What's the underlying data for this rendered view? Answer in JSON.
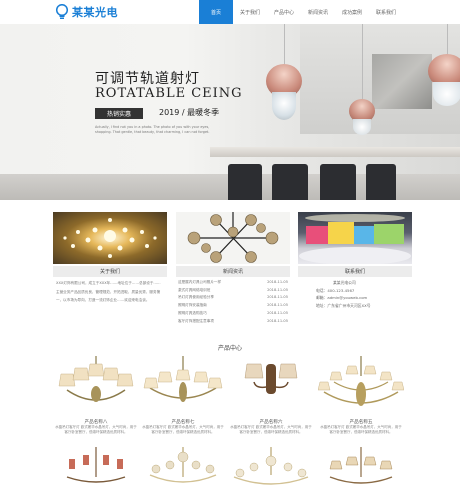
{
  "header": {
    "logo_text": "某某光电",
    "nav": [
      "首页",
      "关于我们",
      "产品中心",
      "新闻资讯",
      "成功案例",
      "联系我们"
    ],
    "active_index": 0,
    "accent_color": "#1a7fd6"
  },
  "banner": {
    "title_cn": "可调节轨道射灯",
    "title_en": "ROTATABLE CEING",
    "button_label": "热销实惠",
    "season_text": "2019 / 最暖冬季",
    "desc": "Actually, I find not you in a photo. The photo of you with your eyes, shopping. That gentle, that beauty, that charming, I can not forget."
  },
  "about": {
    "title": "关于我们",
    "text": "XXX灯饰有限公司，成立于XXX年……地址位于……总部设于……主营业务产品品质优良，管理规范，开拓进取，质量优秀，服务第一，以市场为导向，打造一流灯饰企业……欢迎来电洽谈。"
  },
  "news": {
    "title": "新闻资讯",
    "items": [
      {
        "text": "这是展内灯具公司照片一样",
        "date": "2018-11-05"
      },
      {
        "text": "激式灯具网络培训班",
        "date": "2018-11-05"
      },
      {
        "text": "吊灯灯具使用经验分享",
        "date": "2018-11-05"
      },
      {
        "text": "照明灯饰安装指南",
        "date": "2018-11-05"
      },
      {
        "text": "照明灯具选购技巧",
        "date": "2018-11-05"
      },
      {
        "text": "客厅灯饰搭配注意事项",
        "date": "2018-11-05"
      }
    ]
  },
  "contact": {
    "title": "联系我们",
    "company": "某某光电公司",
    "phone": "电话：400-123-4567",
    "email": "邮箱：admin@youweb.com",
    "address": "地址：广东省广州市天河区XX号"
  },
  "products": {
    "title": "产品中心",
    "items": [
      {
        "name": "产品名称八",
        "desc": "水晶吊灯客厅灯 欧式奢华水晶吊灯，大气时尚，用于客厅卧室餐厅，低碳环保精选优质材料。"
      },
      {
        "name": "产品名称七",
        "desc": "水晶吊灯客厅灯 欧式奢华水晶吊灯，大气时尚，用于客厅卧室餐厅，低碳环保精选优质材料。"
      },
      {
        "name": "产品名称六",
        "desc": "水晶吊灯客厅灯 欧式奢华水晶吊灯，大气时尚，用于客厅卧室餐厅，低碳环保精选优质材料。"
      },
      {
        "name": "产品名称五",
        "desc": "水晶吊灯客厅灯 欧式奢华水晶吊灯，大气时尚，用于客厅卧室餐厅，低碳环保精选优质材料。"
      }
    ]
  }
}
